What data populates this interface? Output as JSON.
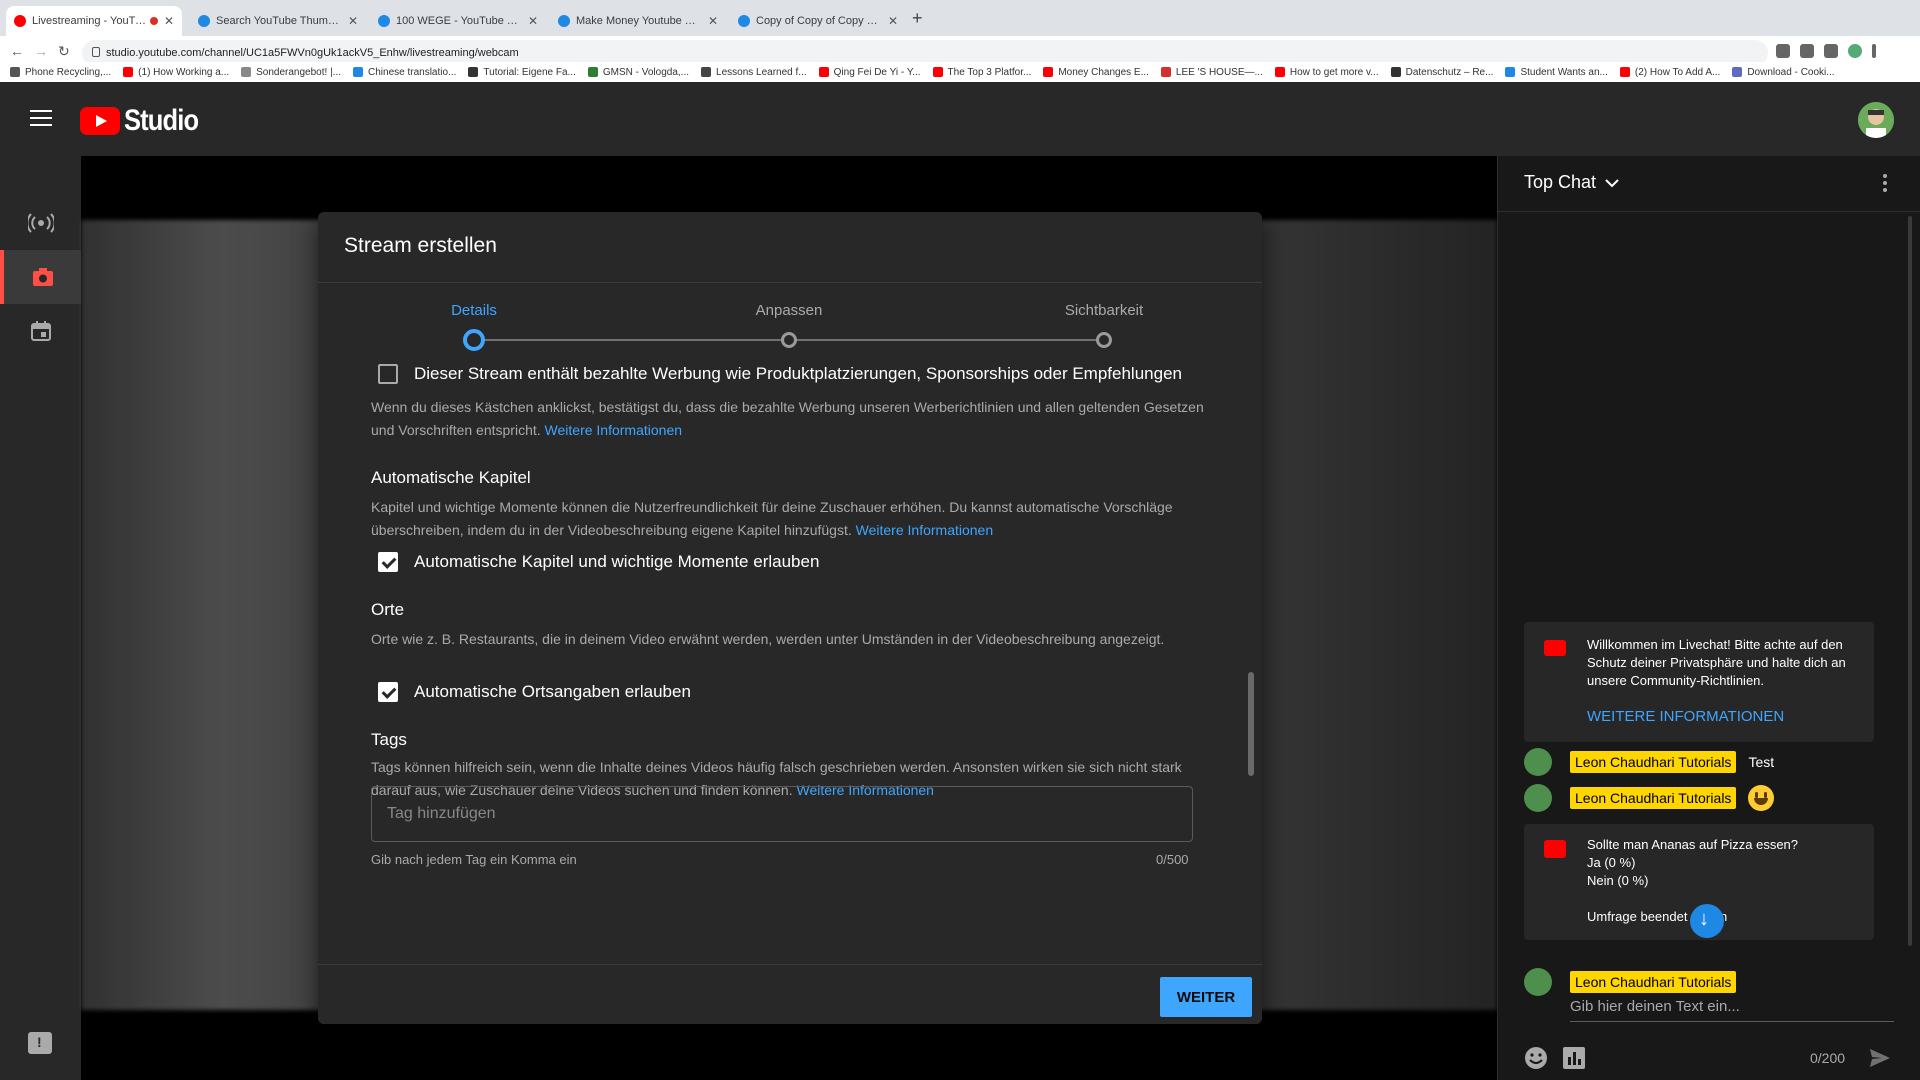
{
  "browser": {
    "tabs": [
      {
        "title": "Livestreaming - YouTube S",
        "active": true,
        "fav_color": "#ff0000"
      },
      {
        "title": "Search YouTube Thumbnail - C",
        "active": false,
        "fav_color": "#1e88e5"
      },
      {
        "title": "100 WEGE - YouTube Thumbna",
        "active": false,
        "fav_color": "#1e88e5"
      },
      {
        "title": "Make Money Youtube Thumbn",
        "active": false,
        "fav_color": "#1e88e5"
      },
      {
        "title": "Copy of Copy of Copy of Copy",
        "active": false,
        "fav_color": "#1e88e5"
      }
    ],
    "url": "studio.youtube.com/channel/UC1a5FWVn0gUk1ackV5_Enhw/livestreaming/webcam",
    "bookmarks": [
      "Phone Recycling,...",
      "(1) How Working a...",
      "Sonderangebot! |...",
      "Chinese translatio...",
      "Tutorial: Eigene Fa...",
      "GMSN - Vologda,...",
      "Lessons Learned f...",
      "Qing Fei De Yi - Y...",
      "The Top 3 Platfor...",
      "Money Changes E...",
      "LEE 'S HOUSE—...",
      "How to get more v...",
      "Datenschutz – Re...",
      "Student Wants an...",
      "(2) How To Add A...",
      "Download - Cooki..."
    ]
  },
  "studio": {
    "logo_text": "Studio"
  },
  "dialog": {
    "title": "Stream erstellen",
    "steps": [
      "Details",
      "Anpassen",
      "Sichtbarkeit"
    ],
    "active_step": 0,
    "paid_promo": {
      "label": "Dieser Stream enthält bezahlte Werbung wie Produktplatzierungen, Sponsorships oder Empfehlungen",
      "checked": false,
      "desc": "Wenn du dieses Kästchen anklickst, bestätigst du, dass die bezahlte Werbung unseren Werberichtlinien und allen geltenden Gesetzen und Vorschriften entspricht.",
      "link": "Weitere Informationen"
    },
    "chapters": {
      "heading": "Automatische Kapitel",
      "desc": "Kapitel und wichtige Momente können die Nutzerfreundlichkeit für deine Zuschauer erhöhen. Du kannst automatische Vorschläge überschreiben, indem du in der Videobeschreibung eigene Kapitel hinzufügst.",
      "link": "Weitere Informationen",
      "checkbox_label": "Automatische Kapitel und wichtige Momente erlauben",
      "checked": true
    },
    "places": {
      "heading": "Orte",
      "desc": "Orte wie z. B. Restaurants, die in deinem Video erwähnt werden, werden unter Umständen in der Videobeschreibung angezeigt.",
      "checkbox_label": "Automatische Ortsangaben erlauben",
      "checked": true
    },
    "tags": {
      "heading": "Tags",
      "desc": "Tags können hilfreich sein, wenn die Inhalte deines Videos häufig falsch geschrieben werden. Ansonsten wirken sie sich nicht stark darauf aus, wie Zuschauer deine Videos suchen und finden können.",
      "link": "Weitere Informationen",
      "placeholder": "Tag hinzufügen",
      "hint": "Gib nach jedem Tag ein Komma ein",
      "count": "0/500"
    },
    "next_button": "WEITER"
  },
  "chat": {
    "title": "Top Chat",
    "welcome": {
      "text": "Willkommen im Livechat! Bitte achte auf den Schutz deiner Privatsphäre und halte dich an unsere Community-Richtlinien.",
      "link": "WEITERE INFORMATIONEN"
    },
    "messages": [
      {
        "author": "Leon Chaudhari Tutorials",
        "text": "Test",
        "emoji": false
      },
      {
        "author": "Leon Chaudhari Tutorials",
        "text": "",
        "emoji": true
      }
    ],
    "poll": {
      "question": "Sollte man Ananas auf Pizza essen?",
      "options": [
        "Ja (0 %)",
        "Nein (0 %)"
      ],
      "footer": "Umfrage beendet mmen"
    },
    "input": {
      "author": "Leon Chaudhari Tutorials",
      "placeholder": "Gib hier deinen Text ein...",
      "count": "0/200"
    }
  },
  "colors": {
    "accent": "#3ea6ff",
    "youtube_red": "#ff0000",
    "author_badge": "#ffd600"
  }
}
